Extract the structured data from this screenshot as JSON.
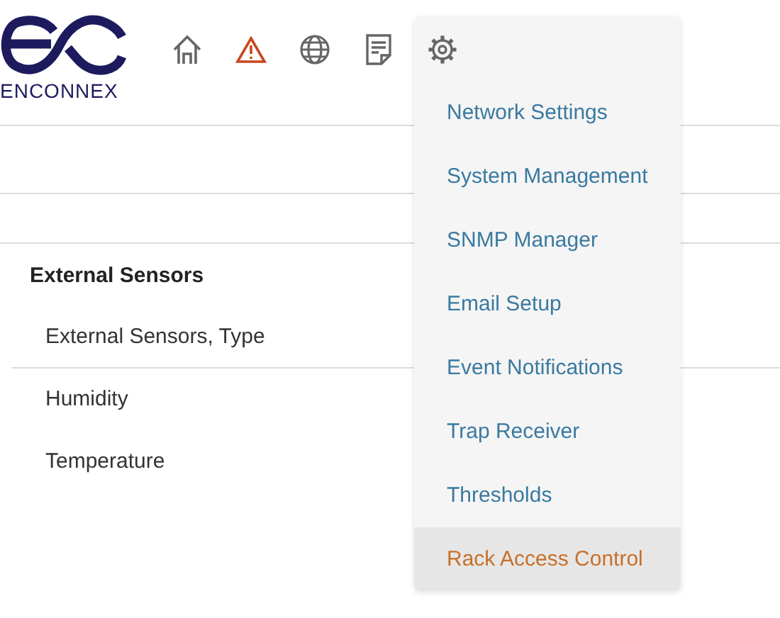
{
  "logo": {
    "text": "ENCONNEX"
  },
  "nav_icons": [
    {
      "kind": "home"
    },
    {
      "kind": "alert"
    },
    {
      "kind": "globe"
    },
    {
      "kind": "document"
    },
    {
      "kind": "settings"
    }
  ],
  "section": {
    "title": "External Sensors",
    "rows": [
      {
        "label": "External Sensors, Type"
      },
      {
        "label": "Humidity"
      },
      {
        "label": "Temperature"
      }
    ]
  },
  "settings_menu": {
    "items": [
      {
        "label": "Network Settings",
        "selected": false
      },
      {
        "label": "System Management",
        "selected": false
      },
      {
        "label": "SNMP Manager",
        "selected": false
      },
      {
        "label": "Email Setup",
        "selected": false
      },
      {
        "label": "Event Notifications",
        "selected": false
      },
      {
        "label": "Trap Receiver",
        "selected": false
      },
      {
        "label": "Thresholds",
        "selected": false
      },
      {
        "label": "Rack Access Control",
        "selected": true
      }
    ]
  }
}
